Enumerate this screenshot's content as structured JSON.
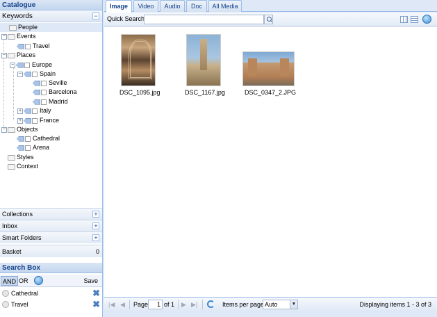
{
  "catalogue": {
    "title": "Catalogue",
    "keywords_header": "Keywords",
    "tree": [
      {
        "label": "People"
      },
      {
        "label": "Events"
      },
      {
        "label": "Travel"
      },
      {
        "label": "Places"
      },
      {
        "label": "Europe"
      },
      {
        "label": "Spain"
      },
      {
        "label": "Seville"
      },
      {
        "label": "Barcelona"
      },
      {
        "label": "Madrid"
      },
      {
        "label": "Italy"
      },
      {
        "label": "France"
      },
      {
        "label": "Objects"
      },
      {
        "label": "Cathedral"
      },
      {
        "label": "Arena"
      },
      {
        "label": "Styles"
      },
      {
        "label": "Context"
      }
    ],
    "sections": [
      {
        "label": "Collections"
      },
      {
        "label": "Inbox"
      },
      {
        "label": "Smart Folders"
      }
    ],
    "basket": {
      "label": "Basket",
      "count": "0"
    }
  },
  "search_box": {
    "title": "Search Box",
    "and_label": "AND",
    "or_label": "OR",
    "save_label": "Save",
    "criteria": [
      {
        "label": "Cathedral"
      },
      {
        "label": "Travel"
      }
    ]
  },
  "tabs": [
    {
      "label": "Image",
      "active": true
    },
    {
      "label": "Video"
    },
    {
      "label": "Audio"
    },
    {
      "label": "Doc"
    },
    {
      "label": "All Media"
    }
  ],
  "quick_search": {
    "label": "Quick Search:",
    "value": ""
  },
  "gallery": [
    {
      "filename": "DSC_1095.jpg"
    },
    {
      "filename": "DSC_1167.jpg"
    },
    {
      "filename": "DSC_0347_2.JPG"
    }
  ],
  "pager": {
    "page_label": "Page",
    "page_value": "1",
    "of_label": "of 1",
    "items_per_page_label": "Items per page:",
    "items_per_page_value": "Auto",
    "display_info": "Displaying items 1 - 3 of 3"
  }
}
